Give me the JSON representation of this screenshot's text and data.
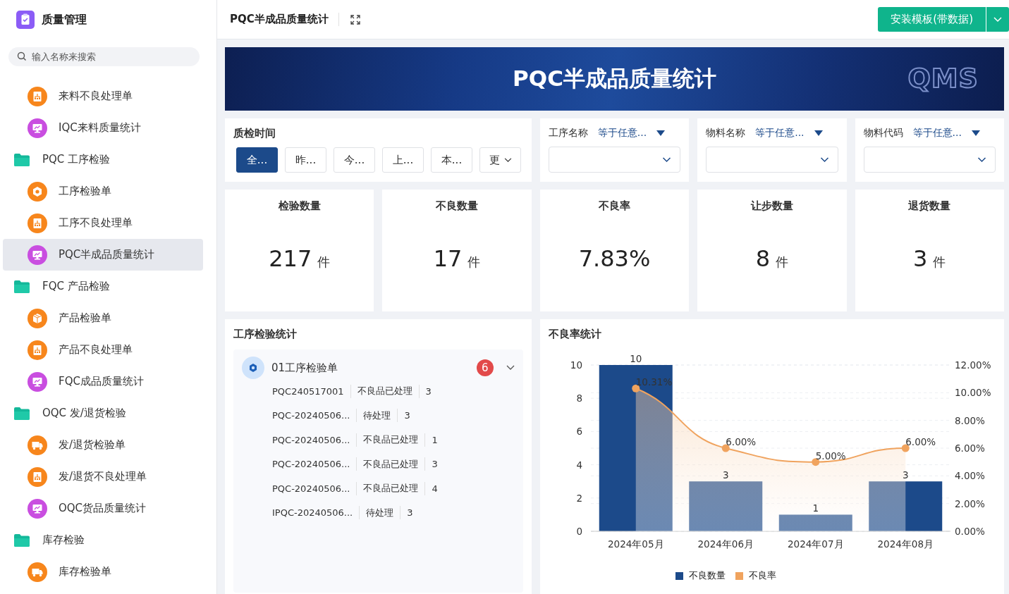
{
  "app": {
    "title": "质量管理"
  },
  "search": {
    "placeholder": "输入名称来搜索"
  },
  "sidebar": {
    "items": [
      {
        "kind": "handling",
        "label": "来料不良处理单",
        "selected": false
      },
      {
        "kind": "statistics",
        "label": "IQC来料质量统计",
        "selected": false
      },
      {
        "kind": "folder",
        "label": "PQC 工序检验",
        "children": [
          {
            "kind": "inspection",
            "label": "工序检验单",
            "selected": false
          },
          {
            "kind": "handling",
            "label": "工序不良处理单",
            "selected": false
          },
          {
            "kind": "statistics",
            "label": "PQC半成品质量统计",
            "selected": true
          }
        ]
      },
      {
        "kind": "folder",
        "label": "FQC 产品检验",
        "children": [
          {
            "kind": "product",
            "label": "产品检验单",
            "selected": false
          },
          {
            "kind": "handling",
            "label": "产品不良处理单",
            "selected": false
          },
          {
            "kind": "statistics",
            "label": "FQC成品质量统计",
            "selected": false
          }
        ]
      },
      {
        "kind": "folder",
        "label": "OQC 发/退货检验",
        "children": [
          {
            "kind": "shipment",
            "label": "发/退货检验单",
            "selected": false
          },
          {
            "kind": "handling",
            "label": "发/退货不良处理单",
            "selected": false
          },
          {
            "kind": "statistics",
            "label": "OQC货品质量统计",
            "selected": false
          }
        ]
      },
      {
        "kind": "folder",
        "label": "库存检验",
        "children": [
          {
            "kind": "shipment",
            "label": "库存检验单",
            "selected": false
          }
        ]
      }
    ]
  },
  "header": {
    "title": "PQC半成品质量统计",
    "button": "安装模板(带数据)"
  },
  "banner": {
    "title": "PQC半成品质量统计",
    "logo": "QMS"
  },
  "time_filter": {
    "label": "质检时间",
    "options": [
      {
        "label": "全...",
        "selected": true
      },
      {
        "label": "昨...",
        "selected": false
      },
      {
        "label": "今...",
        "selected": false
      },
      {
        "label": "上...",
        "selected": false
      },
      {
        "label": "本...",
        "selected": false
      },
      {
        "label": "更",
        "selected": false,
        "kind": "dropdown"
      }
    ]
  },
  "filters": [
    {
      "label": "工序名称",
      "operator": "等于任意..."
    },
    {
      "label": "物料名称",
      "operator": "等于任意..."
    },
    {
      "label": "物料代码",
      "operator": "等于任意..."
    }
  ],
  "kpis": [
    {
      "title": "检验数量",
      "value": "217",
      "unit": "件"
    },
    {
      "title": "不良数量",
      "value": "17",
      "unit": "件"
    },
    {
      "title": "不良率",
      "value": "7.83%"
    },
    {
      "title": "让步数量",
      "value": "8",
      "unit": "件"
    },
    {
      "title": "退货数量",
      "value": "3",
      "unit": "件"
    }
  ],
  "inspection_stats": {
    "title": "工序检验统计",
    "groups": [
      {
        "title": "01工序检验单",
        "count": "6",
        "expanded": true,
        "rows": [
          {
            "code": "PQC240517001",
            "status": "不良品已处理",
            "qty": "3"
          },
          {
            "code": "PQC-20240506...",
            "status": "待处理",
            "qty": "3"
          },
          {
            "code": "PQC-20240506...",
            "status": "不良品已处理",
            "qty": "1"
          },
          {
            "code": "PQC-20240506...",
            "status": "不良品已处理",
            "qty": "3"
          },
          {
            "code": "PQC-20240506...",
            "status": "不良品已处理",
            "qty": "4"
          },
          {
            "code": "IPQC-20240506...",
            "status": "待处理",
            "qty": "3"
          }
        ]
      }
    ]
  },
  "defect_chart": {
    "title": "不良率统计",
    "chart_data": {
      "type": "bar",
      "categories": [
        "2024年05月",
        "2024年06月",
        "2024年07月",
        "2024年08月"
      ],
      "series": [
        {
          "name": "不良数量",
          "color": "#1c4a8a",
          "type": "bar",
          "values": [
            10,
            3,
            1,
            3
          ],
          "value_labels": [
            "10",
            "3",
            "1",
            "3"
          ]
        },
        {
          "name": "不良率",
          "color": "#f0a35e",
          "type": "area",
          "axis": "y2",
          "marker": "circle",
          "values": [
            10.31,
            6,
            5,
            6
          ],
          "value_labels": [
            "10.31%",
            "6.00%",
            "5.00%",
            "6.00%"
          ]
        }
      ],
      "ylim": [
        0,
        10
      ],
      "yticks": [
        {
          "value": 0,
          "label": "0"
        },
        {
          "value": 2,
          "label": "2"
        },
        {
          "value": 4,
          "label": "4"
        },
        {
          "value": 6,
          "label": "6"
        },
        {
          "value": 8,
          "label": "8"
        },
        {
          "value": 10,
          "label": "10"
        }
      ],
      "y2lim": [
        0,
        12
      ],
      "y2ticks": [
        {
          "value": 0,
          "label": "0.00%"
        },
        {
          "value": 2,
          "label": "2.00%"
        },
        {
          "value": 4,
          "label": "4.00%"
        },
        {
          "value": 6,
          "label": "6.00%"
        },
        {
          "value": 8,
          "label": "8.00%"
        },
        {
          "value": 10,
          "label": "10.00%"
        },
        {
          "value": 12,
          "label": "12.00%"
        }
      ],
      "grid": true,
      "data_labels": "value_labels"
    }
  }
}
